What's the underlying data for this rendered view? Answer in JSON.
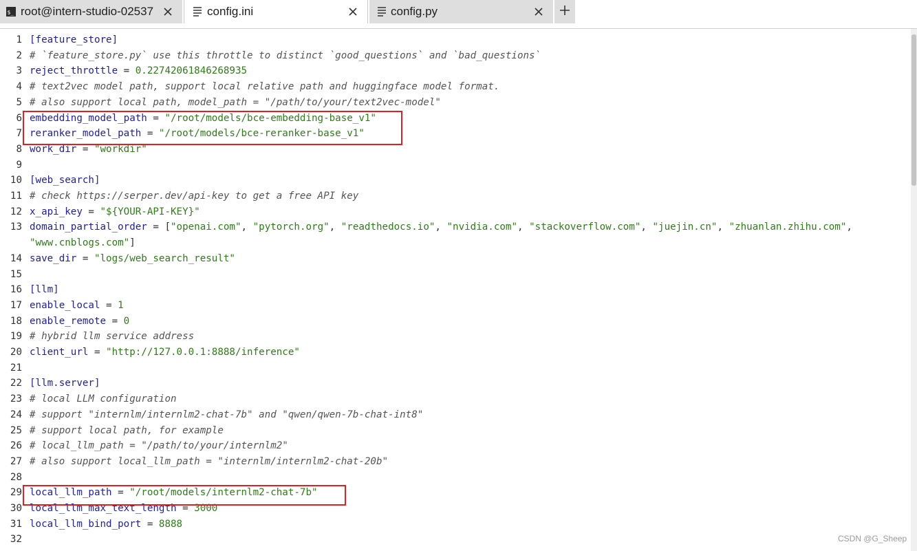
{
  "tabs": [
    {
      "label": "root@intern-studio-02537",
      "icon": "terminal-icon",
      "state": "inactive"
    },
    {
      "label": "config.ini",
      "icon": "document-icon",
      "state": "active"
    },
    {
      "label": "config.py",
      "icon": "document-icon",
      "state": "inactive"
    }
  ],
  "add_tab_icon": "plus-icon",
  "lines": [
    {
      "n": "1",
      "parts": [
        {
          "t": "sec",
          "v": "[feature_store]"
        }
      ]
    },
    {
      "n": "2",
      "parts": [
        {
          "t": "cmt",
          "v": "# `feature_store.py` use this throttle to distinct `good_questions` and `bad_questions`"
        }
      ]
    },
    {
      "n": "3",
      "parts": [
        {
          "t": "key",
          "v": "reject_throttle"
        },
        {
          "t": "op",
          "v": " = "
        },
        {
          "t": "num",
          "v": "0.22742061846268935"
        }
      ]
    },
    {
      "n": "4",
      "parts": [
        {
          "t": "cmt",
          "v": "# text2vec model path, support local relative path and huggingface model format."
        }
      ]
    },
    {
      "n": "5",
      "parts": [
        {
          "t": "cmt",
          "v": "# also support local path, model_path = \"/path/to/your/text2vec-model\""
        }
      ]
    },
    {
      "n": "6",
      "parts": [
        {
          "t": "key",
          "v": "embedding_model_path"
        },
        {
          "t": "op",
          "v": " = "
        },
        {
          "t": "str",
          "v": "\"/root/models/bce-embedding-base_v1\""
        }
      ]
    },
    {
      "n": "7",
      "parts": [
        {
          "t": "key",
          "v": "reranker_model_path"
        },
        {
          "t": "op",
          "v": " = "
        },
        {
          "t": "str",
          "v": "\"/root/models/bce-reranker-base_v1\""
        }
      ]
    },
    {
      "n": "8",
      "parts": [
        {
          "t": "key",
          "v": "work_dir"
        },
        {
          "t": "op",
          "v": " = "
        },
        {
          "t": "str",
          "v": "\"workdir\""
        }
      ]
    },
    {
      "n": "9",
      "parts": []
    },
    {
      "n": "10",
      "parts": [
        {
          "t": "sec",
          "v": "[web_search]"
        }
      ]
    },
    {
      "n": "11",
      "parts": [
        {
          "t": "cmt",
          "v": "# check https://serper.dev/api-key to get a free API key"
        }
      ]
    },
    {
      "n": "12",
      "parts": [
        {
          "t": "key",
          "v": "x_api_key"
        },
        {
          "t": "op",
          "v": " = "
        },
        {
          "t": "str",
          "v": "\"${YOUR-API-KEY}\""
        }
      ]
    },
    {
      "n": "13",
      "parts": [
        {
          "t": "key",
          "v": "domain_partial_order"
        },
        {
          "t": "op",
          "v": " = ["
        },
        {
          "t": "str",
          "v": "\"openai.com\""
        },
        {
          "t": "op",
          "v": ", "
        },
        {
          "t": "str",
          "v": "\"pytorch.org\""
        },
        {
          "t": "op",
          "v": ", "
        },
        {
          "t": "str",
          "v": "\"readthedocs.io\""
        },
        {
          "t": "op",
          "v": ", "
        },
        {
          "t": "str",
          "v": "\"nvidia.com\""
        },
        {
          "t": "op",
          "v": ", "
        },
        {
          "t": "str",
          "v": "\"stackoverflow.com\""
        },
        {
          "t": "op",
          "v": ", "
        },
        {
          "t": "str",
          "v": "\"juejin.cn\""
        },
        {
          "t": "op",
          "v": ", "
        },
        {
          "t": "str",
          "v": "\"zhuanlan.zhihu.com\""
        },
        {
          "t": "op",
          "v": ","
        }
      ]
    },
    {
      "n": "",
      "parts": [
        {
          "t": "str",
          "v": "\"www.cnblogs.com\""
        },
        {
          "t": "op",
          "v": "]"
        }
      ]
    },
    {
      "n": "14",
      "parts": [
        {
          "t": "key",
          "v": "save_dir"
        },
        {
          "t": "op",
          "v": " = "
        },
        {
          "t": "str",
          "v": "\"logs/web_search_result\""
        }
      ]
    },
    {
      "n": "15",
      "parts": []
    },
    {
      "n": "16",
      "parts": [
        {
          "t": "sec",
          "v": "[llm]"
        }
      ]
    },
    {
      "n": "17",
      "parts": [
        {
          "t": "key",
          "v": "enable_local"
        },
        {
          "t": "op",
          "v": " = "
        },
        {
          "t": "num",
          "v": "1"
        }
      ]
    },
    {
      "n": "18",
      "parts": [
        {
          "t": "key",
          "v": "enable_remote"
        },
        {
          "t": "op",
          "v": " = "
        },
        {
          "t": "num",
          "v": "0"
        }
      ]
    },
    {
      "n": "19",
      "parts": [
        {
          "t": "cmt",
          "v": "# hybrid llm service address"
        }
      ]
    },
    {
      "n": "20",
      "parts": [
        {
          "t": "key",
          "v": "client_url"
        },
        {
          "t": "op",
          "v": " = "
        },
        {
          "t": "str",
          "v": "\"http://127.0.0.1:8888/inference\""
        }
      ]
    },
    {
      "n": "21",
      "parts": []
    },
    {
      "n": "22",
      "parts": [
        {
          "t": "sec",
          "v": "[llm.server]"
        }
      ]
    },
    {
      "n": "23",
      "parts": [
        {
          "t": "cmt",
          "v": "# local LLM configuration"
        }
      ]
    },
    {
      "n": "24",
      "parts": [
        {
          "t": "cmt",
          "v": "# support \"internlm/internlm2-chat-7b\" and \"qwen/qwen-7b-chat-int8\""
        }
      ]
    },
    {
      "n": "25",
      "parts": [
        {
          "t": "cmt",
          "v": "# support local path, for example"
        }
      ]
    },
    {
      "n": "26",
      "parts": [
        {
          "t": "cmt",
          "v": "# local_llm_path = \"/path/to/your/internlm2\""
        }
      ]
    },
    {
      "n": "27",
      "parts": [
        {
          "t": "cmt",
          "v": "# also support local_llm_path = \"internlm/internlm2-chat-20b\""
        }
      ]
    },
    {
      "n": "28",
      "parts": []
    },
    {
      "n": "29",
      "parts": [
        {
          "t": "key",
          "v": "local_llm_path"
        },
        {
          "t": "op",
          "v": " = "
        },
        {
          "t": "str",
          "v": "\"/root/models/internlm2-chat-7b\""
        }
      ]
    },
    {
      "n": "30",
      "parts": [
        {
          "t": "key",
          "v": "local_llm_max_text_length"
        },
        {
          "t": "op",
          "v": " = "
        },
        {
          "t": "num",
          "v": "3000"
        }
      ]
    },
    {
      "n": "31",
      "parts": [
        {
          "t": "key",
          "v": "local_llm_bind_port"
        },
        {
          "t": "op",
          "v": " = "
        },
        {
          "t": "num",
          "v": "8888"
        }
      ]
    },
    {
      "n": "32",
      "parts": []
    }
  ],
  "highlight_color": "#e02020",
  "watermark": "CSDN @G_Sheep"
}
